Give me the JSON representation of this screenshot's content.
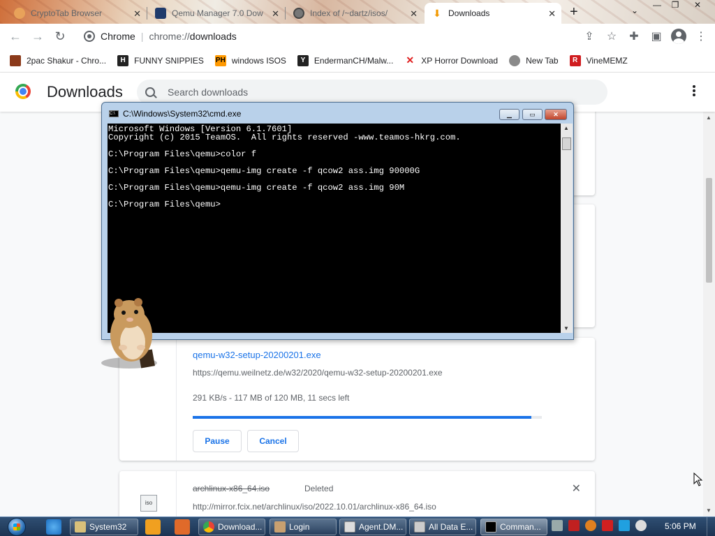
{
  "browser": {
    "tabs": [
      {
        "title": "CryptoTab Browser",
        "active": false
      },
      {
        "title": "Qemu Manager 7.0 Dow",
        "active": false
      },
      {
        "title": "Index of /~dartz/isos/",
        "active": false
      },
      {
        "title": "Downloads",
        "active": true
      }
    ],
    "new_tab_glyph": "+",
    "omnibox": {
      "site_label": "Chrome",
      "scheme": "chrome://",
      "host": "downloads"
    },
    "bookmarks": [
      {
        "label": "2pac Shakur - Chro...",
        "icon": "2pac-favicon",
        "color": "#8b3a1a"
      },
      {
        "label": "FUNNY SNIPPIES",
        "icon": "h-favicon",
        "color": "#222222"
      },
      {
        "label": "windows ISOS",
        "icon": "ph-favicon",
        "color": "#ff9900"
      },
      {
        "label": "EndermanCH/Malw...",
        "icon": "yp-favicon",
        "color": "#222222"
      },
      {
        "label": "XP Horror Download",
        "icon": "x-favicon",
        "color": "#e02020"
      },
      {
        "label": "New Tab",
        "icon": "newtab-favicon",
        "color": "#8a8a8a"
      },
      {
        "label": "VineMEMZ",
        "icon": "r-favicon",
        "color": "#d01c1f"
      }
    ]
  },
  "downloads_page": {
    "title": "Downloads",
    "search_placeholder": "Search downloads",
    "active_item": {
      "filename": "qemu-w32-setup-20200201.exe",
      "url": "https://qemu.weilnetz.de/w32/2020/qemu-w32-setup-20200201.exe",
      "status": "291 KB/s - 117 MB of 120 MB, 11 secs left",
      "progress_fraction": 0.97,
      "pause_label": "Pause",
      "cancel_label": "Cancel"
    },
    "deleted_item": {
      "filename": "archlinux-x86_64.iso",
      "status": "Deleted",
      "url": "http://mirror.fcix.net/archlinux/iso/2022.10.01/archlinux-x86_64.iso",
      "icon_label": "iso",
      "remove_glyph": "✕"
    }
  },
  "cmd_window": {
    "title": "C:\\Windows\\System32\\cmd.exe",
    "lines": [
      "Microsoft Windows [Version 6.1.7601]",
      "Copyright (c) 2015 TeamOS.  All rights reserved -www.teamos-hkrg.com.",
      "",
      "C:\\Program Files\\qemu>color f",
      "",
      "C:\\Program Files\\qemu>qemu-img create -f qcow2 ass.img 90000G",
      "",
      "C:\\Program Files\\qemu>qemu-img create -f qcow2 ass.img 90M",
      "",
      "C:\\Program Files\\qemu>"
    ]
  },
  "taskbar": {
    "tasks": [
      {
        "label": "System32",
        "icon": "folder-icon",
        "active": false
      },
      {
        "label": "Download...",
        "icon": "chrome-icon",
        "active": false
      },
      {
        "label": "Login",
        "icon": "login-icon",
        "active": false
      },
      {
        "label": "Agent.DM...",
        "icon": "agent-icon",
        "active": false
      },
      {
        "label": "All Data E...",
        "icon": "window-icon",
        "active": false
      },
      {
        "label": "Comman...",
        "icon": "cmd-icon",
        "active": true
      }
    ],
    "clock": "5:06 PM"
  },
  "colors": {
    "accent": "#1a73e8",
    "progress_track": "#e8eaed",
    "taskbar": "#1c3352"
  }
}
